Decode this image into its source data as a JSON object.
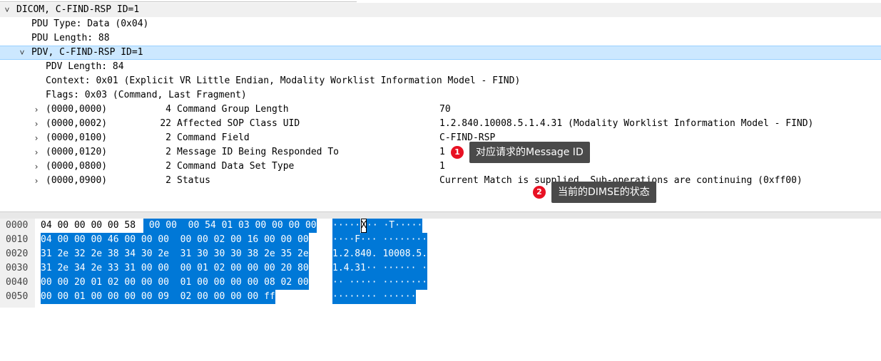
{
  "tree": {
    "dicom_label": "DICOM, C-FIND-RSP ID=1",
    "pdu_type": "PDU Type: Data (0x04)",
    "pdu_length": "PDU Length: 88",
    "pdv_label": "PDV, C-FIND-RSP ID=1",
    "pdv_length": "PDV Length: 84",
    "context": "Context: 0x01 (Explicit VR Little Endian, Modality Worklist Information Model - FIND)",
    "flags": "Flags: 0x03 (Command, Last Fragment)",
    "elements": [
      {
        "tag": "(0000,0000)",
        "len": "4",
        "name": "Command Group Length",
        "value": "70"
      },
      {
        "tag": "(0000,0002)",
        "len": "22",
        "name": "Affected SOP Class UID",
        "value": "1.2.840.10008.5.1.4.31 (Modality Worklist Information Model - FIND)"
      },
      {
        "tag": "(0000,0100)",
        "len": "2",
        "name": "Command Field",
        "value": "C-FIND-RSP"
      },
      {
        "tag": "(0000,0120)",
        "len": "2",
        "name": "Message ID Being Responded To",
        "value": "1"
      },
      {
        "tag": "(0000,0800)",
        "len": "2",
        "name": "Command Data Set Type",
        "value": "1"
      },
      {
        "tag": "(0000,0900)",
        "len": "2",
        "name": "Status",
        "value": "Current Match is supplied. Sub-operations are continuing (0xff00)"
      }
    ]
  },
  "annotations": [
    {
      "number": "1",
      "text": "对应请求的Message ID"
    },
    {
      "number": "2",
      "text": "当前的DIMSE的状态"
    }
  ],
  "hex": {
    "rows": [
      {
        "offset": "0000",
        "plain_hex": "04 00 00 00 00 58",
        "sel_hex": " 00 00  00 54 01 03 00 00 00 00",
        "ascii": [
          {
            "t": "·····",
            "hl": true
          },
          {
            "t": "X",
            "hl": false,
            "cur": true
          },
          {
            "t": "·· ·T·····",
            "hl": true
          }
        ]
      },
      {
        "offset": "0010",
        "hex": "04 00 00 00 46 00 00 00  00 00 02 00 16 00 00 00",
        "ascii": "····F··· ········"
      },
      {
        "offset": "0020",
        "hex": "31 2e 32 2e 38 34 30 2e  31 30 30 30 38 2e 35 2e",
        "ascii": "1.2.840. 10008.5."
      },
      {
        "offset": "0030",
        "hex": "31 2e 34 2e 33 31 00 00  00 01 02 00 00 00 20 80",
        "ascii": "1.4.31·· ······ ·"
      },
      {
        "offset": "0040",
        "hex": "00 00 20 01 02 00 00 00  01 00 00 00 00 08 02 00",
        "ascii": "·· ····· ········"
      },
      {
        "offset": "0050",
        "hex": "00 00 01 00 00 00 00 09  02 00 00 00 00 ff",
        "ascii": "········ ······"
      }
    ]
  }
}
